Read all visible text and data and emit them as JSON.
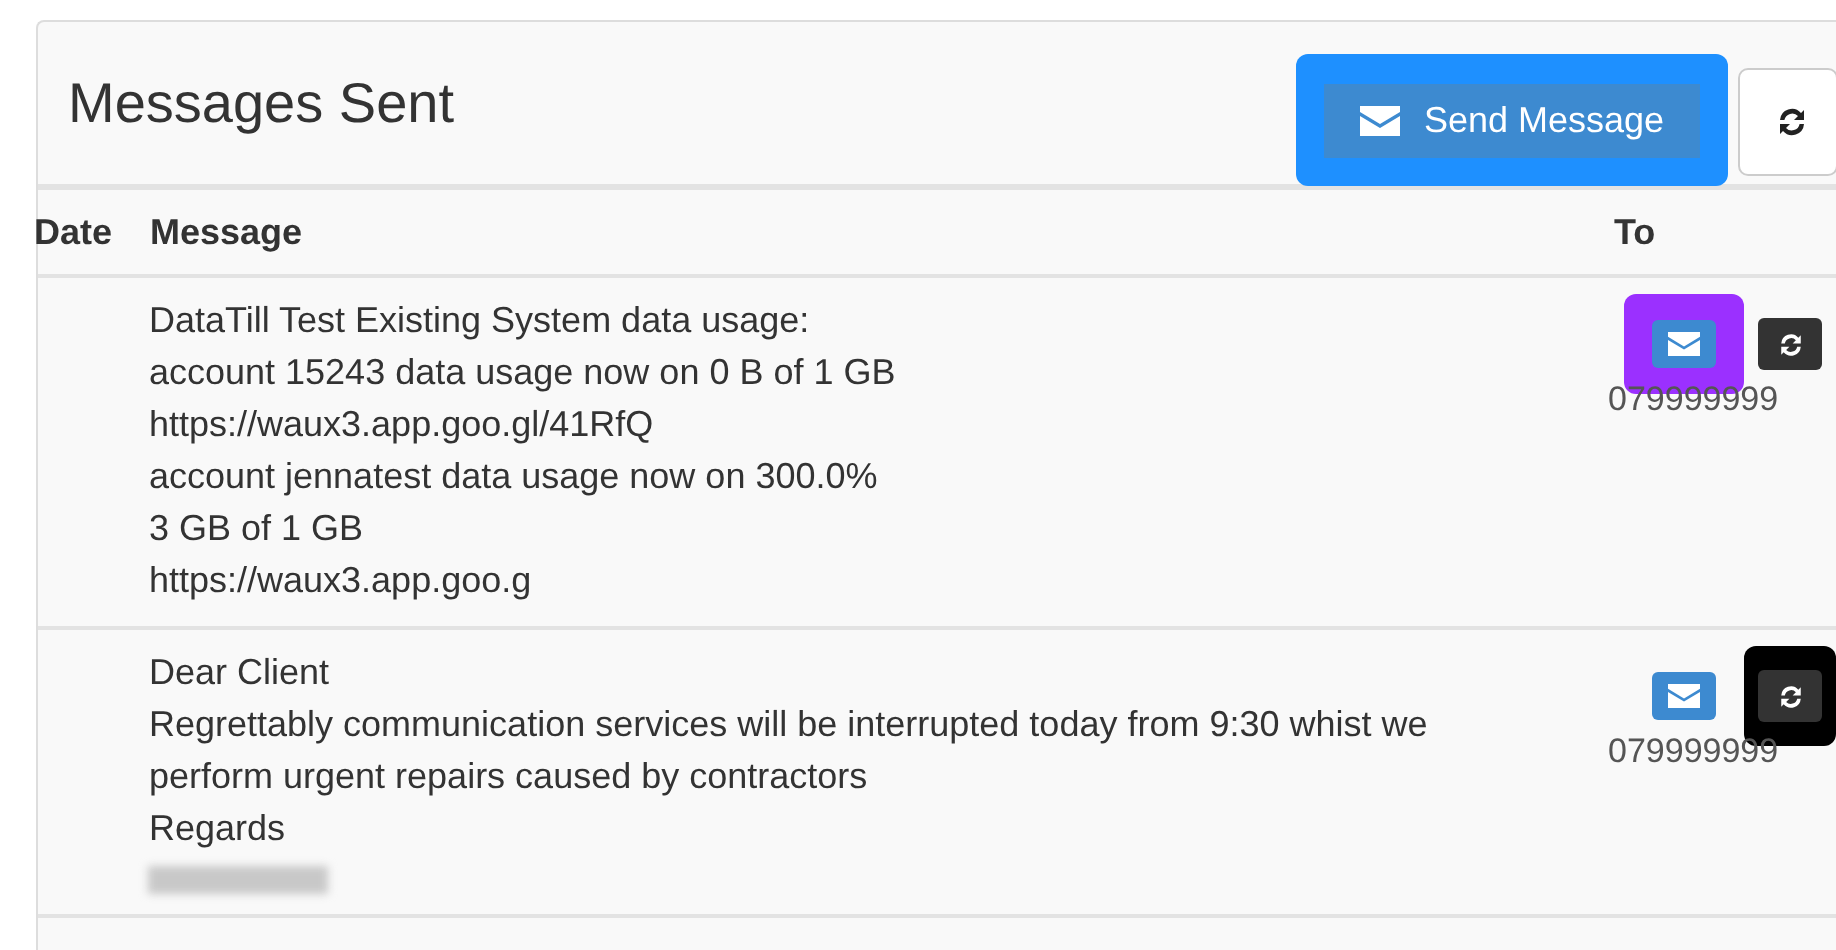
{
  "panel": {
    "title": "Messages Sent",
    "send_button": {
      "label": "Send Message",
      "highlighted": true
    }
  },
  "table": {
    "columns": [
      "Date",
      "Message",
      "To"
    ],
    "rows": [
      {
        "message_lines": [
          "DataTill Test Existing System data usage:",
          "account 15243 data usage now on 0 B of 1 GB",
          "https://waux3.app.goo.gl/41RfQ",
          "account jennatest data usage now on 300.0%",
          "3 GB of 1 GB",
          "https://waux3.app.goo.g"
        ],
        "redacted": false,
        "to": "079999999",
        "mail_highlighted": true,
        "refresh_highlighted": false
      },
      {
        "message_lines": [
          "Dear Client",
          "Regrettably communication services will be interrupted today from 9:30 whist we perform urgent repairs caused by contractors",
          "Regards"
        ],
        "redacted": true,
        "to": "079999999",
        "mail_highlighted": false,
        "refresh_highlighted": true
      }
    ]
  }
}
